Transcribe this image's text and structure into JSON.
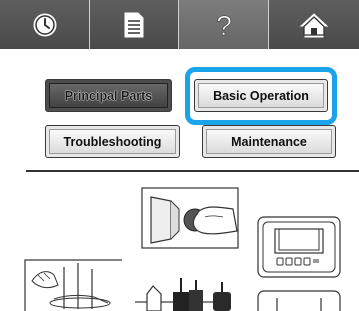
{
  "toolbar": {
    "buttons": [
      {
        "name": "clock-icon"
      },
      {
        "name": "document-icon"
      },
      {
        "name": "help-icon",
        "label": "?"
      },
      {
        "name": "home-icon"
      }
    ]
  },
  "categories": {
    "principal_parts": "Principal Parts",
    "basic_operation": "Basic Operation",
    "troubleshooting": "Troubleshooting",
    "maintenance": "Maintenance",
    "selected": "Principal Parts",
    "focused": "Basic Operation"
  },
  "colors": {
    "toolbar_bg": "#545454",
    "focus_ring": "#1aa3e8",
    "active_button": "#4a4a4a"
  }
}
